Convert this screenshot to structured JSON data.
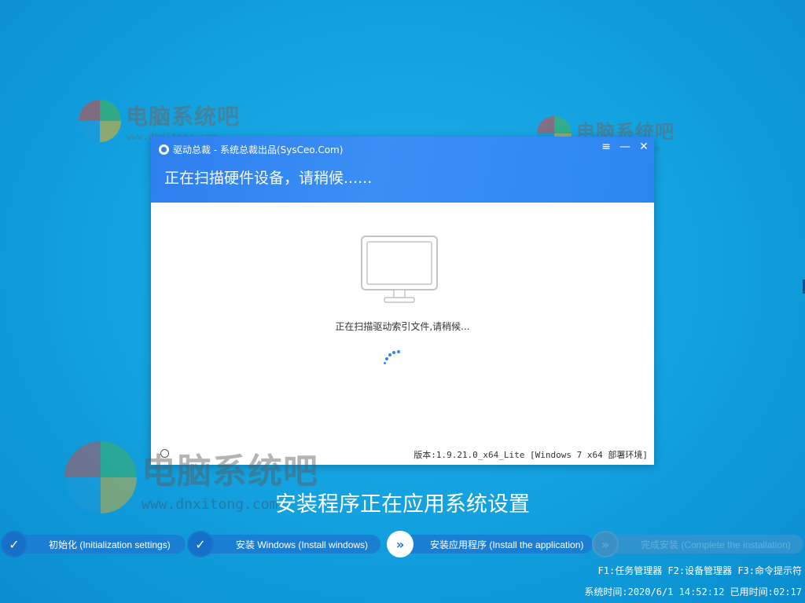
{
  "watermark": {
    "title": "电脑系统吧",
    "url": "www.dnxitong.com"
  },
  "window": {
    "title": "驱动总裁 - 系统总裁出品(SysCeo.Com)",
    "controls": {
      "menu": "≡",
      "minimize": "—",
      "close": "✕"
    },
    "header_message": "正在扫描硬件设备，请稍候......",
    "scan_status": "正在扫描驱动索引文件,请稍候...",
    "footer_option": "",
    "version": "版本:1.9.21.0_x64_Lite [Windows 7 x64 部署环境]"
  },
  "install_message": "安装程序正在应用系统设置",
  "steps": [
    {
      "label": "初始化 (Initialization settings)",
      "state": "done",
      "icon": "check-icon"
    },
    {
      "label": "安装 Windows (Install windows)",
      "state": "done",
      "icon": "check-icon"
    },
    {
      "label": "安装应用程序 (Install the application)",
      "state": "current",
      "icon": "double-chevron-icon"
    },
    {
      "label": "完成安装 (Complete the installation)",
      "state": "pending",
      "icon": "double-chevron-icon"
    }
  ],
  "hotkeys": "F1:任务管理器 F2:设备管理器 F3:命令提示符",
  "clock": "系统时间:2020/6/1 14:52:12 已用时间:02:17",
  "colors": {
    "background": "#12a0df",
    "header_blue": "#2e7ff0",
    "step_blue": "#1a7fd3",
    "spinner": "#2f86ef"
  }
}
